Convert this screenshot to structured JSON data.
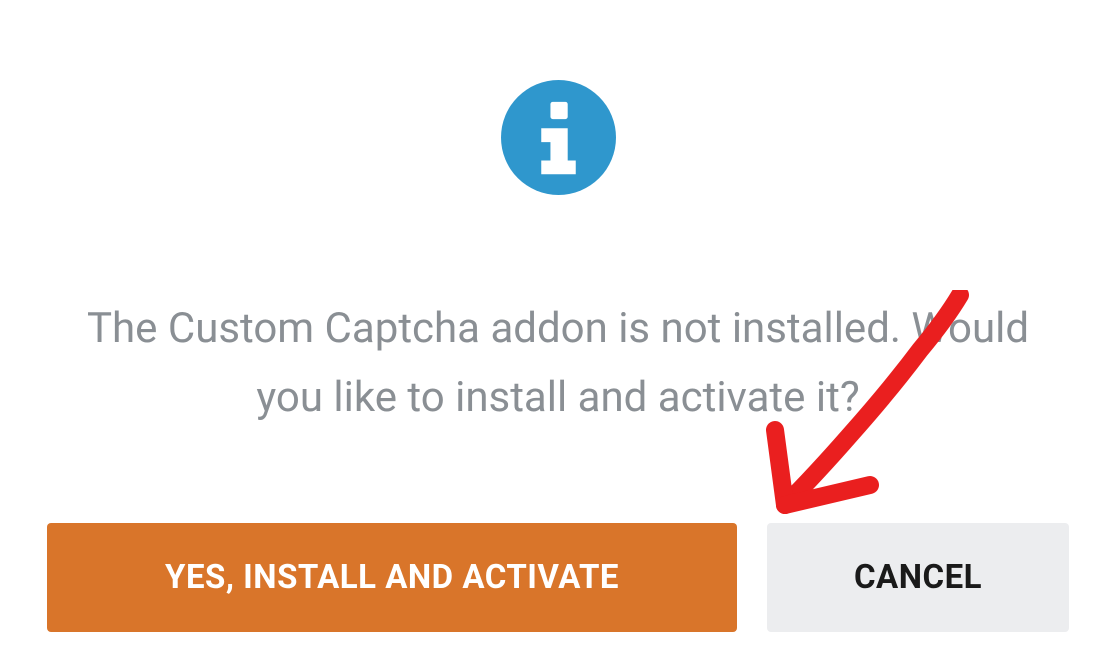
{
  "dialog": {
    "message": "The Custom Captcha addon is not installed. Would you like to install and activate it?",
    "icon": "info-icon",
    "buttons": {
      "confirm_label": "YES, INSTALL AND ACTIVATE",
      "cancel_label": "CANCEL"
    }
  },
  "colors": {
    "info_icon": "#2f97cd",
    "primary_button": "#d9752a",
    "secondary_button": "#ecedef",
    "text_muted": "#8a8f94",
    "arrow": "#ea1f1f"
  }
}
